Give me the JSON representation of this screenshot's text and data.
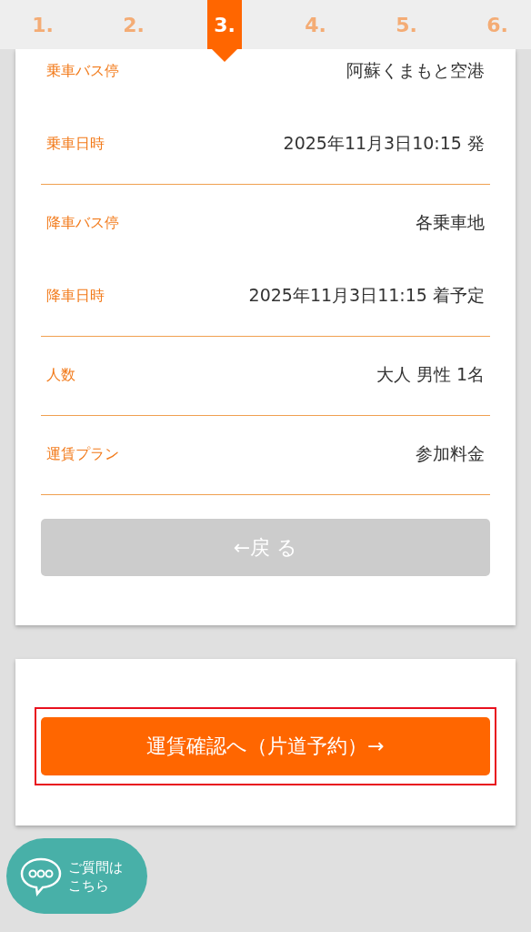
{
  "steps": [
    {
      "label": "1.",
      "selected": false
    },
    {
      "label": "2.",
      "selected": false
    },
    {
      "label": "3.",
      "selected": true
    },
    {
      "label": "4.",
      "selected": false
    },
    {
      "label": "5.",
      "selected": false
    },
    {
      "label": "6.",
      "selected": false
    }
  ],
  "detail_groups": [
    {
      "rows": [
        {
          "label": "乗車バス停",
          "value": "阿蘇くまもと空港"
        },
        {
          "label": "乗車日時",
          "value": "2025年11月3日10:15 発"
        }
      ]
    },
    {
      "rows": [
        {
          "label": "降車バス停",
          "value": "各乗車地"
        },
        {
          "label": "降車日時",
          "value": "2025年11月3日11:15 着予定"
        }
      ]
    },
    {
      "rows": [
        {
          "label": "人数",
          "value": "大人 男性 1名"
        }
      ]
    },
    {
      "rows": [
        {
          "label": "運賃プラン",
          "value": "参加料金"
        }
      ]
    }
  ],
  "back_button": "←戻 る",
  "next_button": "運賃確認へ（片道予約）→",
  "chat_button": {
    "line_1": "ご質問は",
    "line_2": "こちら"
  }
}
